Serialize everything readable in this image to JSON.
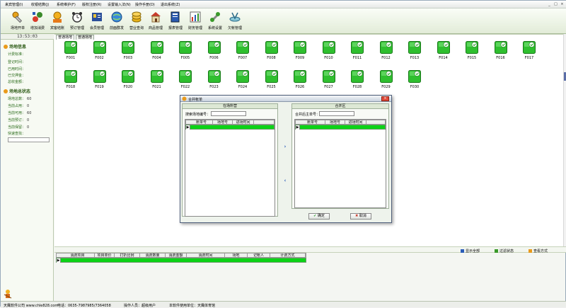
{
  "menu": {
    "items": [
      "来宾管理(I)",
      "收银结算(J)",
      "系统维护(F)",
      "版权注册(R)",
      "设置输入法(N)",
      "操作手册(D)",
      "退出系统(Z)"
    ]
  },
  "window_controls": [
    "_",
    "□",
    "×"
  ],
  "toolbar": {
    "buttons": [
      {
        "label": "场地开单",
        "icon": "key-open-icon"
      },
      {
        "label": "增加消费",
        "icon": "add-consume-icon"
      },
      {
        "label": "宾客结账",
        "icon": "checkout-icon"
      },
      {
        "label": "预订管理",
        "icon": "alarm-clock-icon"
      },
      {
        "label": "会员管理",
        "icon": "member-card-icon"
      },
      {
        "label": "前面群发",
        "icon": "globe-icon"
      },
      {
        "label": "营业查询",
        "icon": "money-icon"
      },
      {
        "label": "商品管理",
        "icon": "house-icon"
      },
      {
        "label": "报表管理",
        "icon": "book-icon"
      },
      {
        "label": "财务管理",
        "icon": "chart-icon"
      },
      {
        "label": "系统设置",
        "icon": "tools-icon"
      },
      {
        "label": "欠帐管理",
        "icon": "dish-icon"
      }
    ]
  },
  "left_panel": {
    "clock": "13:53:03",
    "info_title": "场地信息",
    "info_rows": [
      {
        "label": "计费标准：",
        "value": ""
      },
      {
        "label": "登记时间：",
        "value": ""
      },
      {
        "label": "已用时间：",
        "value": ""
      },
      {
        "label": "已交押金：",
        "value": ""
      },
      {
        "label": "总收金额：",
        "value": ""
      }
    ],
    "status_title": "场地总状态",
    "status_rows": [
      {
        "label": "场地总数：",
        "value": "60"
      },
      {
        "label": "当前占用：",
        "value": "0"
      },
      {
        "label": "当前可用：",
        "value": "60"
      },
      {
        "label": "当前预订：",
        "value": "0"
      },
      {
        "label": "当前保留：",
        "value": "0"
      },
      {
        "label": "快速查找：",
        "value": ""
      }
    ]
  },
  "tabs": [
    "普通场地",
    "普通场地"
  ],
  "courts": {
    "row1": [
      "F001",
      "F002",
      "F003",
      "F004",
      "F005",
      "F006",
      "F007",
      "F008",
      "F009",
      "F010",
      "F011",
      "F012",
      "F013",
      "F014",
      "F015",
      "F016",
      "F017"
    ],
    "row2": [
      "F018",
      "F019",
      "F020",
      "F021",
      "F022",
      "F023",
      "F024",
      "F025",
      "F026",
      "F027",
      "F028",
      "F029",
      "F030"
    ]
  },
  "bottom_bar": {
    "show_all": "显示全部",
    "filter_status": "过滤状态",
    "view_detail": "查看方式"
  },
  "consume_grid": {
    "headers": [
      "消费项目",
      "项目单价",
      "打折比例",
      "消费数量",
      "消费金额",
      "消费时间",
      "场地",
      "记帐人",
      "计费方式"
    ]
  },
  "status_bar": {
    "company": "天鹰软件公司 www.chle828.com",
    "phone": "电话：0635-7987985/7364058",
    "operator": "操作人员：超级用户",
    "licensee": "本软件使用单位：天鹰体育馆"
  },
  "dialog": {
    "title": "合并帐单",
    "left_panel_title": "在场所营",
    "left_field_label": "搜索场地编号：",
    "left_headers": [
      "账单号",
      "场地号",
      "进场时间"
    ],
    "right_panel_title": "合并区",
    "right_field_label": "合并后主单号：",
    "right_headers": [
      "账单号",
      "场地号",
      "进场时间"
    ],
    "move_right": "›",
    "move_left": "‹",
    "ok_label": "确定",
    "cancel_label": "取消",
    "close_label": "×"
  },
  "colors": {
    "court_green": "#2fbf2f",
    "row_highlight": "#0bd316",
    "accent_orange": "#e99a1c"
  }
}
